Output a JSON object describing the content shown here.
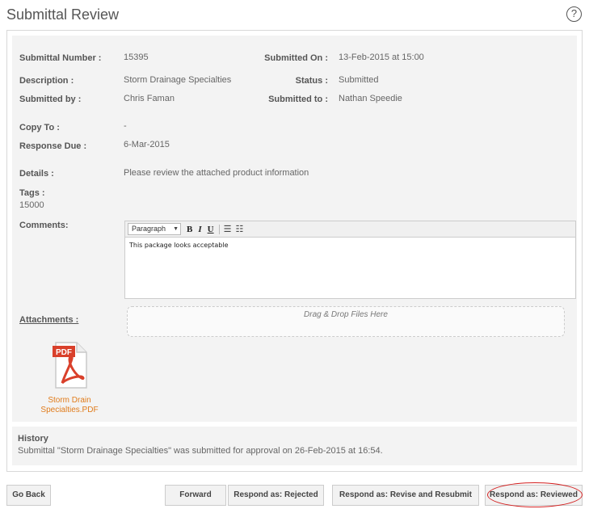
{
  "page": {
    "title": "Submittal Review",
    "help_icon": "?"
  },
  "fields": {
    "submittal_number_label": "Submittal Number :",
    "submittal_number": "15395",
    "submitted_on_label": "Submitted On :",
    "submitted_on": "13-Feb-2015 at 15:00",
    "description_label": "Description :",
    "description": "Storm Drainage Specialties",
    "status_label": "Status :",
    "status": "Submitted",
    "submitted_by_label": "Submitted by :",
    "submitted_by": "Chris Faman",
    "submitted_to_label": "Submitted to :",
    "submitted_to": "Nathan Speedie",
    "copy_to_label": "Copy To :",
    "copy_to": "-",
    "response_due_label": "Response Due :",
    "response_due": "6-Mar-2015",
    "details_label": "Details :",
    "details": "Please review the attached product information",
    "tags_label": "Tags :",
    "tags": "15000"
  },
  "comments": {
    "label": "Comments:",
    "format": "Paragraph",
    "bold": "B",
    "italic": "I",
    "underline": "U",
    "text": "This package looks acceptable"
  },
  "attachments": {
    "label": "Attachments :",
    "dropzone": "Drag & Drop Files Here",
    "file_name": "Storm Drain Specialties.PDF",
    "pdf_badge": "PDF"
  },
  "history": {
    "title": "History",
    "entry": "Submittal \"Storm Drainage Specialties\" was submitted for approval on 26-Feb-2015 at 16:54."
  },
  "buttons": {
    "go_back": "Go Back",
    "forward": "Forward",
    "rejected": "Respond as: Rejected",
    "revise": "Respond as: Revise and Resubmit",
    "reviewed": "Respond as: Reviewed"
  },
  "colors": {
    "highlight": "#d32020",
    "file_link": "#e07b1a",
    "pdf_red": "#d9402b"
  }
}
